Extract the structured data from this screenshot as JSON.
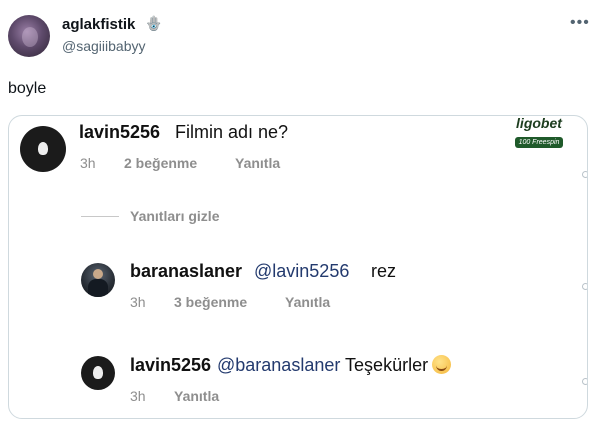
{
  "tweet": {
    "author_name": "aglakfistik",
    "author_handle": "@sagiiibabyy",
    "verified_emoji": "🪬",
    "text": "boyle"
  },
  "colors": {
    "mention": "#233a6e",
    "meta_gray": "#8e8e8e",
    "brand_green": "#1f5a2a"
  },
  "ad": {
    "brand": "ligobet",
    "badge": "100 Freespin"
  },
  "comments": [
    {
      "user": "lavin5256",
      "text": "Filmin adı ne?",
      "time": "3h",
      "likes": "2 beğenme",
      "reply": "Yanıtla"
    }
  ],
  "hide_replies": "Yanıtları gizle",
  "replies": [
    {
      "user": "baranaslaner",
      "mention": "@lavin5256",
      "text": "rez",
      "time": "3h",
      "likes": "3 beğenme",
      "reply": "Yanıtla"
    },
    {
      "user": "lavin5256",
      "mention": "@baranaslaner",
      "text": "Teşekürler",
      "emoji": "smile-icon",
      "time": "3h",
      "reply": "Yanıtla"
    }
  ]
}
